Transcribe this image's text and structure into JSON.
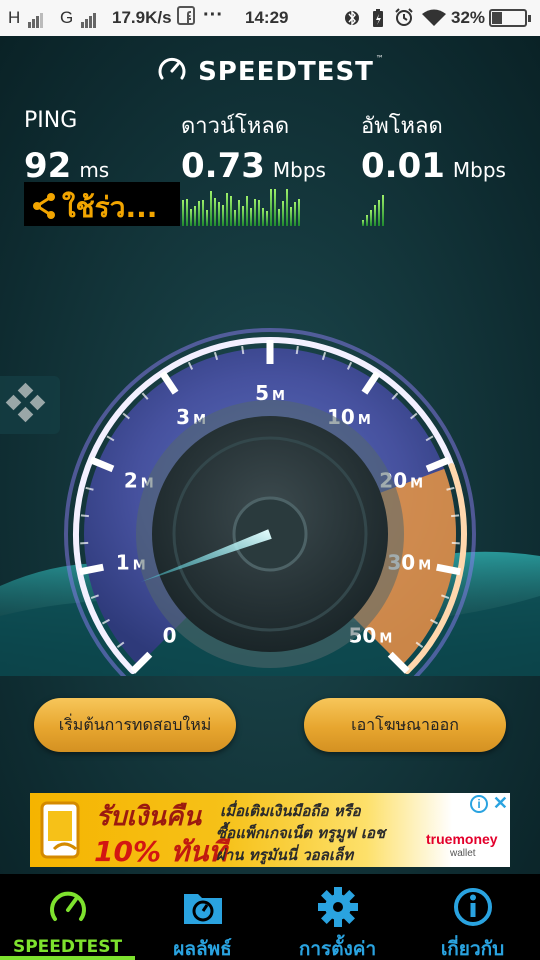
{
  "status_bar": {
    "carrier1": "H",
    "carrier2": "G",
    "speed": "17.9K/s",
    "dots": "···",
    "time": "14:29",
    "battery": "32%",
    "battery_level": 0.32,
    "icons": [
      "bluetooth-icon",
      "battery-saver-icon",
      "alarm-icon",
      "wifi-icon",
      "facebook-icon"
    ]
  },
  "header": {
    "title": "SPEEDTEST",
    "tm": "™"
  },
  "metrics": {
    "ping": {
      "label": "PING",
      "value": "92",
      "unit": "ms"
    },
    "download": {
      "label": "ดาวน์โหลด",
      "value": "0.73",
      "unit": "Mbps"
    },
    "upload": {
      "label": "อัพโหลด",
      "value": "0.01",
      "unit": "Mbps"
    }
  },
  "share": {
    "label": "ใช้ร่ว..."
  },
  "gauge": {
    "ticks": [
      {
        "num": "0",
        "u": ""
      },
      {
        "num": "1",
        "u": "M"
      },
      {
        "num": "2",
        "u": "M"
      },
      {
        "num": "3",
        "u": "M"
      },
      {
        "num": "5",
        "u": "M"
      },
      {
        "num": "10",
        "u": "M"
      },
      {
        "num": "20",
        "u": "M"
      },
      {
        "num": "30",
        "u": "M"
      },
      {
        "num": "50",
        "u": "M"
      }
    ],
    "needle_value": 0.73,
    "colors": {
      "arc": "#8b7cf2",
      "accent": "#f39a3c",
      "needle": "#bff6ff"
    }
  },
  "buttons": {
    "retest": "เริ่มต้นการทดสอบใหม่",
    "remove_ads": "เอาโฆษณาออก"
  },
  "ad": {
    "line1": "รับเงินคืน",
    "pct": "10%",
    "line2": "ทันที",
    "text1": "เมื่อเติมเงินมือถือ หรือ",
    "text2": "ซื้อแพ็กเกจเน็ต ทรูมูฟ เอช",
    "text3": "ผ่าน ทรูมันนี่ วอลเล็ท",
    "brand": "truemoney",
    "brand_sub": "wallet",
    "info": "i",
    "close": "✕"
  },
  "nav": {
    "items": [
      {
        "label": "SPEEDTEST",
        "icon": "speedometer-icon",
        "active": true
      },
      {
        "label": "ผลลัพธ์",
        "icon": "results-folder-icon",
        "active": false
      },
      {
        "label": "การตั้งค่า",
        "icon": "gear-icon",
        "active": false
      },
      {
        "label": "เกี่ยวกับ",
        "icon": "info-icon",
        "active": false
      }
    ]
  },
  "colors": {
    "accent_green": "#7ee22e",
    "accent_blue": "#2aa3e0",
    "button_gold": "#e7a62f",
    "share_orange": "#f2a500"
  }
}
